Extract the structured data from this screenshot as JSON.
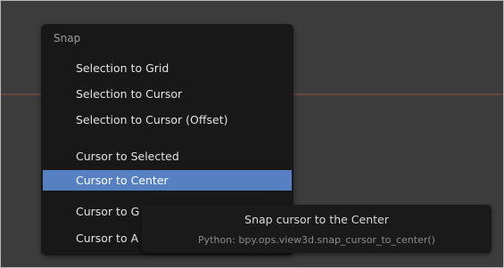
{
  "menu": {
    "title": "Snap",
    "items": [
      {
        "label": "Selection to Grid",
        "active": false
      },
      {
        "label": "Selection to Cursor",
        "active": false
      },
      {
        "label": "Selection to Cursor (Offset)",
        "active": false
      },
      {
        "label": "Cursor to Selected",
        "active": false
      },
      {
        "label": "Cursor to Center",
        "active": true
      },
      {
        "label": "Cursor to G",
        "active": false
      },
      {
        "label": "Cursor to A",
        "active": false
      }
    ]
  },
  "tooltip": {
    "title": "Snap cursor to the Center",
    "python": "Python: bpy.ops.view3d.snap_cursor_to_center()"
  },
  "colors": {
    "menu_bg": "#181818",
    "highlight": "#5680c2",
    "viewport_bg": "#3c3c3c"
  }
}
